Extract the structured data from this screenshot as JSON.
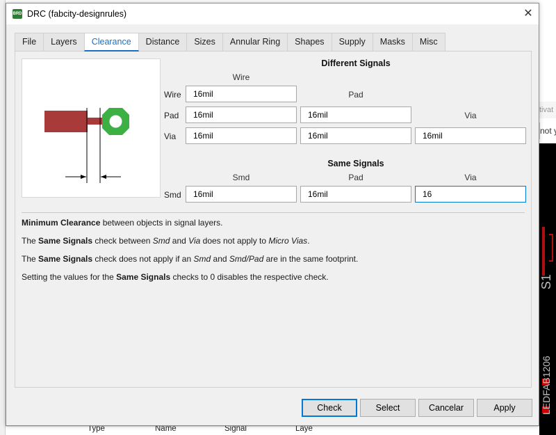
{
  "window": {
    "title": "DRC (fabcity-designrules)",
    "close_glyph": "✕",
    "app_icon_text": "BRD"
  },
  "tabs": [
    {
      "label": "File",
      "active": false
    },
    {
      "label": "Layers",
      "active": false
    },
    {
      "label": "Clearance",
      "active": true
    },
    {
      "label": "Distance",
      "active": false
    },
    {
      "label": "Sizes",
      "active": false
    },
    {
      "label": "Annular Ring",
      "active": false
    },
    {
      "label": "Shapes",
      "active": false
    },
    {
      "label": "Supply",
      "active": false
    },
    {
      "label": "Masks",
      "active": false
    },
    {
      "label": "Misc",
      "active": false
    }
  ],
  "different_signals": {
    "heading": "Different Signals",
    "col_wire": "Wire",
    "col_pad": "Pad",
    "col_via": "Via",
    "row_wire": "Wire",
    "row_pad": "Pad",
    "row_via": "Via",
    "wire_wire": "16mil",
    "pad_wire": "16mil",
    "pad_pad": "16mil",
    "via_wire": "16mil",
    "via_pad": "16mil",
    "via_via": "16mil"
  },
  "same_signals": {
    "heading": "Same Signals",
    "col_smd": "Smd",
    "col_pad": "Pad",
    "col_via": "Via",
    "row_smd": "Smd",
    "smd_smd": "16mil",
    "smd_pad": "16mil",
    "smd_via": "16"
  },
  "description": {
    "line1": {
      "b1": "Minimum Clearance",
      "t1": " between objects in signal layers."
    },
    "line2": {
      "t0": "The ",
      "b1": "Same Signals",
      "t1": " check between ",
      "i1": "Smd",
      "t2": " and ",
      "i2": "Via",
      "t3": " does not apply to ",
      "i3": "Micro Vias",
      "t4": "."
    },
    "line3": {
      "t0": "The ",
      "b1": "Same Signals",
      "t1": " check does not apply if an ",
      "i1": "Smd",
      "t2": " and ",
      "i2": "Smd/Pad",
      "t3": " are in the same footprint."
    },
    "line4": {
      "t0": "Setting the values for the ",
      "b1": "Same Signals",
      "t1": " checks to 0 disables the respective check."
    }
  },
  "buttons": {
    "check": "Check",
    "select": "Select",
    "cancel": "Cancelar",
    "apply": "Apply"
  },
  "background": {
    "right_hint1": "tivat",
    "right_hint2": "not y",
    "right_label1": "S1",
    "right_label2": "LEDFAB1206",
    "bottom_cols": [
      "Type",
      "Name",
      "Signal",
      "Laye"
    ]
  },
  "colors": {
    "accent": "#1e6ebf",
    "copper": "#a83a3a",
    "via_green": "#3cb043"
  }
}
